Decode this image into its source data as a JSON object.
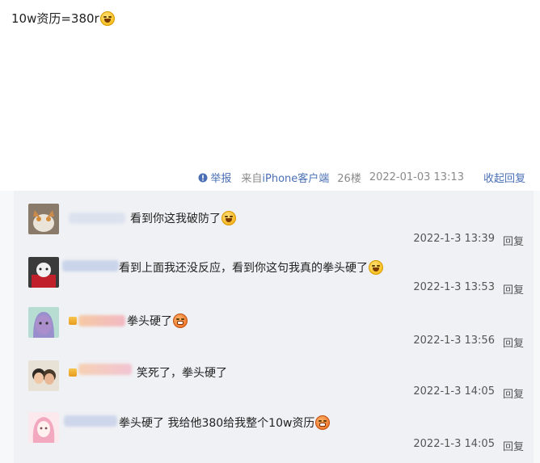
{
  "post": {
    "text": "10w资历=380r",
    "emoji": "grin-sweat-emoji"
  },
  "meta": {
    "report_label": "举报",
    "source_prefix": "来自",
    "source_device": "iPhone客户端",
    "floor": "26楼",
    "timestamp": "2022-01-03 13:13",
    "collapse_label": "收起回复"
  },
  "replies": [
    {
      "text": "看到你这我破防了",
      "emoji": "hug-emoji",
      "time": "2022-1-3 13:39",
      "reply_label": "回复"
    },
    {
      "text": "看到上面我还没反应，看到你这句我真的拳头硬了",
      "emoji": "grin-sweat-emoji",
      "time": "2022-1-3 13:53",
      "reply_label": "回复"
    },
    {
      "text": "拳头硬了",
      "emoji": "angry-emoji",
      "time": "2022-1-3 13:56",
      "reply_label": "回复"
    },
    {
      "text": "笑死了，拳头硬了",
      "emoji": "",
      "time": "2022-1-3 14:05",
      "reply_label": "回复"
    },
    {
      "text": "拳头硬了 我给他380给我整个10w资历",
      "emoji": "angry-emoji",
      "time": "2022-1-3 14:05",
      "reply_label": "回复"
    }
  ],
  "colors": {
    "link": "#4a6fb5",
    "reply_bg": "#f0f1f4",
    "muted": "#8a8a8a"
  }
}
